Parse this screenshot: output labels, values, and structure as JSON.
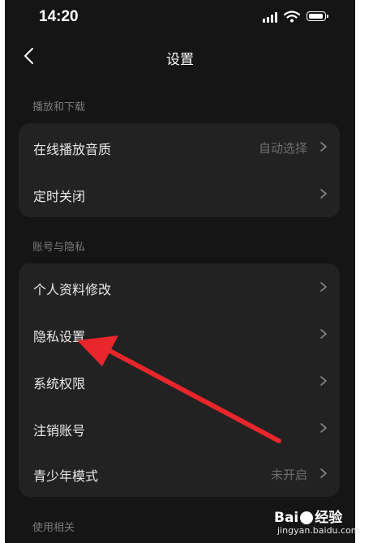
{
  "status_bar": {
    "time": "14:20"
  },
  "nav": {
    "title": "设置"
  },
  "sections": [
    {
      "label": "播放和下载",
      "items": [
        {
          "label": "在线播放音质",
          "value": "自动选择"
        },
        {
          "label": "定时关闭",
          "value": ""
        }
      ]
    },
    {
      "label": "账号与隐私",
      "items": [
        {
          "label": "个人资料修改",
          "value": ""
        },
        {
          "label": "隐私设置",
          "value": ""
        },
        {
          "label": "系统权限",
          "value": ""
        },
        {
          "label": "注销账号",
          "value": ""
        },
        {
          "label": "青少年模式",
          "value": "未开启"
        }
      ]
    },
    {
      "label": "使用相关"
    }
  ],
  "annotation": {
    "color": "#e8262b",
    "target": "隐私设置"
  },
  "watermark": {
    "brand_left": "Bai",
    "brand_right": "经验",
    "url": "jingyan.baidu.com"
  },
  "icons": [
    "signal-icon",
    "wifi-icon",
    "battery-icon",
    "back-chevron-icon",
    "chevron-right-icon"
  ]
}
